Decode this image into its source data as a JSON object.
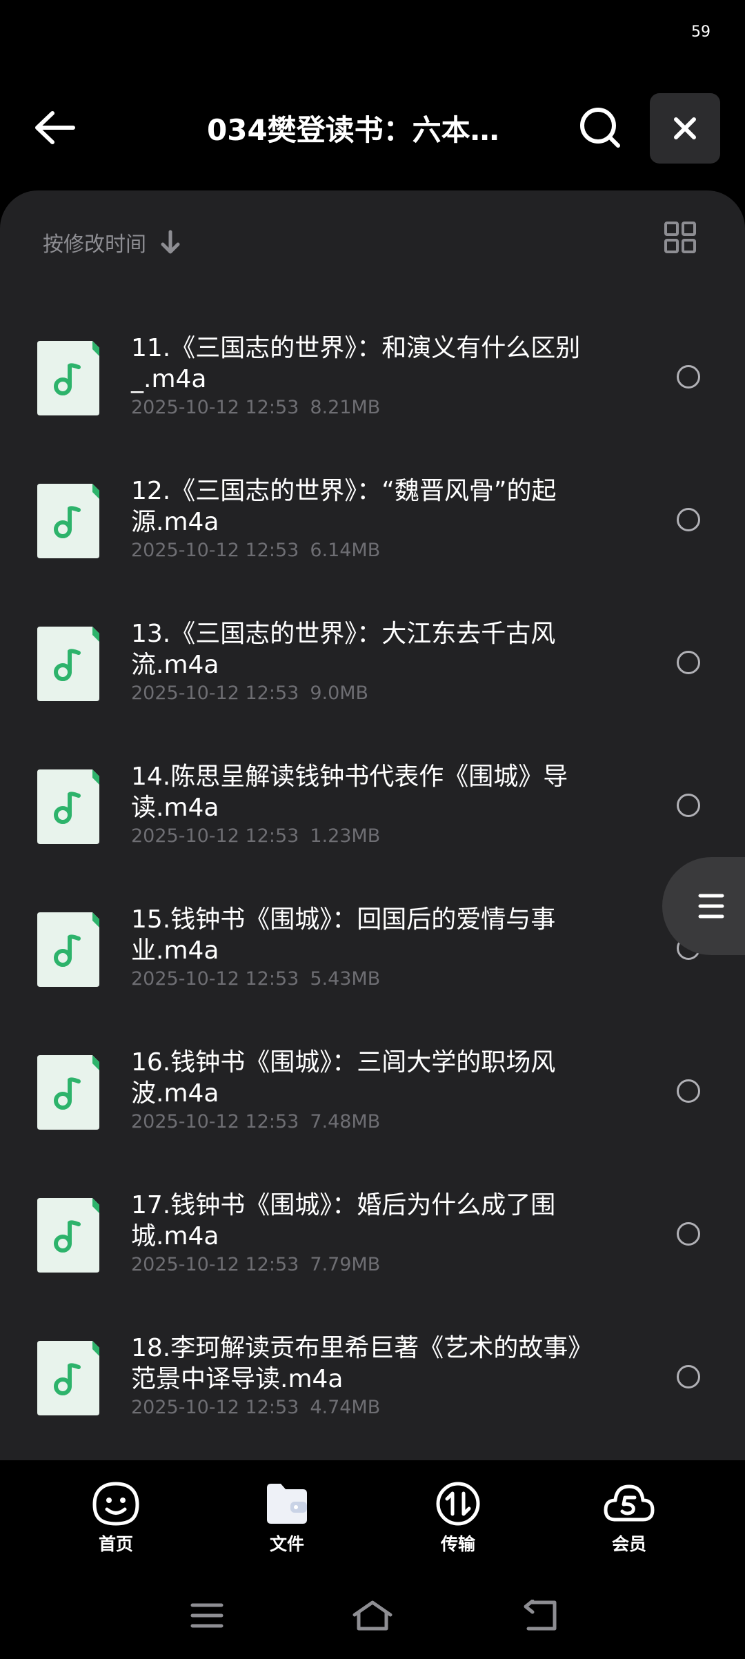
{
  "status": {
    "battery": "59"
  },
  "header": {
    "title": "034樊登读书：六本…"
  },
  "sort": {
    "label": "按修改时间"
  },
  "files": [
    {
      "name": "11.《三国志的世界》：和演义有什么区别_.m4a",
      "date": "2025-10-12 12:53",
      "size": "8.21MB"
    },
    {
      "name": "12.《三国志的世界》：“魏晋风骨”的起源.m4a",
      "date": "2025-10-12 12:53",
      "size": "6.14MB"
    },
    {
      "name": "13.《三国志的世界》：大江东去千古风流.m4a",
      "date": "2025-10-12 12:53",
      "size": "9.0MB"
    },
    {
      "name": "14.陈思呈解读钱钟书代表作《围城》导读.m4a",
      "date": "2025-10-12 12:53",
      "size": "1.23MB"
    },
    {
      "name": "15.钱钟书《围城》：回国后的爱情与事业.m4a",
      "date": "2025-10-12 12:53",
      "size": "5.43MB"
    },
    {
      "name": "16.钱钟书《围城》：三闾大学的职场风波.m4a",
      "date": "2025-10-12 12:53",
      "size": "7.48MB"
    },
    {
      "name": "17.钱钟书《围城》：婚后为什么成了围城.m4a",
      "date": "2025-10-12 12:53",
      "size": "7.79MB"
    },
    {
      "name": "18.李珂解读贡布里希巨著《艺术的故事》范景中译导读.m4a",
      "date": "2025-10-12 12:53",
      "size": "4.74MB"
    }
  ],
  "nav": {
    "home": "首页",
    "files": "文件",
    "transfer": "传输",
    "vip": "会员"
  },
  "colors": {
    "accent": "#2db36b",
    "panel": "#222224",
    "icon_bg": "#e8f3ec"
  }
}
